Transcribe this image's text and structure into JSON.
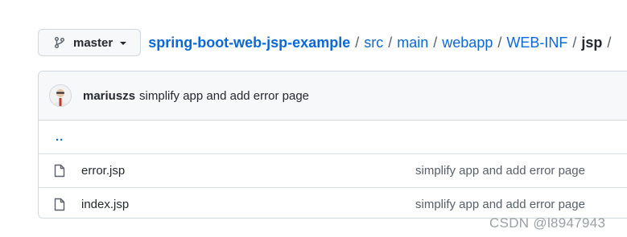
{
  "branch": {
    "label": "master",
    "icon": "git-branch-icon"
  },
  "breadcrumb": {
    "root": "spring-boot-web-jsp-example",
    "segments": [
      "src",
      "main",
      "webapp",
      "WEB-INF"
    ],
    "current": "jsp",
    "separator": "/"
  },
  "latest_commit": {
    "author": "mariuszs",
    "message": "simplify app and add error page"
  },
  "parent_dir": "..",
  "files": [
    {
      "name": "error.jsp",
      "commit": "simplify app and add error page",
      "icon": "file-icon"
    },
    {
      "name": "index.jsp",
      "commit": "simplify app and add error page",
      "icon": "file-icon"
    }
  ],
  "watermark": "CSDN @l8947943",
  "colors": {
    "link": "#0969da",
    "border": "#d0d7de",
    "header_bg": "#f6f8fa",
    "text": "#24292f",
    "muted": "#57606a"
  }
}
